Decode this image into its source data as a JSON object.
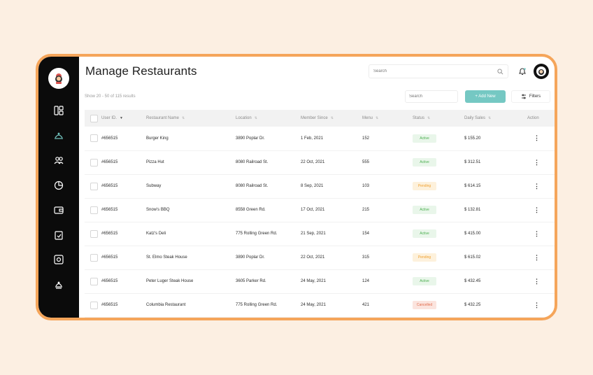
{
  "header": {
    "title": "Manage Restaurants",
    "search_placeholder": "Search"
  },
  "subbar": {
    "results": "Show 20 - 50 of 115 results",
    "search_placeholder": "Search",
    "add_label": "+ Add New",
    "filters_label": "Filters"
  },
  "colors": {
    "accent": "#75c8c3",
    "frame": "#f5a55a",
    "sidebar": "#0b0b0b",
    "active": "#4caf50",
    "pending": "#f0a030",
    "cancelled": "#e06a4a"
  },
  "sidebar": {
    "items": [
      "dashboard-icon",
      "restaurant-icon",
      "users-icon",
      "pie-chart-icon",
      "wallet-icon",
      "clipboard-check-icon",
      "settings-icon",
      "chef-icon"
    ]
  },
  "table": {
    "columns": [
      "User ID.",
      "Restaurant Name",
      "Location",
      "Member Since",
      "Menu",
      "Status",
      "Daily Sales",
      "Action"
    ],
    "rows": [
      {
        "id": "#656515",
        "name": "Burger King",
        "location": "3890 Poplar Dr.",
        "since": "1 Feb, 2021",
        "menu": "152",
        "status": "Active",
        "sales": "$ 155.20"
      },
      {
        "id": "#656515",
        "name": "Pizza Hut",
        "location": "8080 Railroad St.",
        "since": "22 Oct, 2021",
        "menu": "555",
        "status": "Active",
        "sales": "$ 312.51"
      },
      {
        "id": "#656515",
        "name": "Subway",
        "location": "8080 Railroad St.",
        "since": "8 Sep, 2021",
        "menu": "103",
        "status": "Pending",
        "sales": "$ 614.15"
      },
      {
        "id": "#656515",
        "name": "Snow's BBQ",
        "location": "8558 Green Rd.",
        "since": "17 Oct, 2021",
        "menu": "215",
        "status": "Active",
        "sales": "$ 132.81"
      },
      {
        "id": "#656515",
        "name": "Katz's Deli",
        "location": "775 Rolling Green Rd.",
        "since": "21 Sep, 2021",
        "menu": "154",
        "status": "Active",
        "sales": "$ 415.00"
      },
      {
        "id": "#656515",
        "name": "St. Elmo Steak House",
        "location": "3890 Poplar Dr.",
        "since": "22 Oct, 2021",
        "menu": "315",
        "status": "Pending",
        "sales": "$ 615.02"
      },
      {
        "id": "#656515",
        "name": "Peter Luger Steak House",
        "location": "3605 Parker Rd.",
        "since": "24 May, 2021",
        "menu": "124",
        "status": "Active",
        "sales": "$ 432.45"
      },
      {
        "id": "#656515",
        "name": "Columbia Restaurant",
        "location": "775 Rolling Green Rd.",
        "since": "24 May, 2021",
        "menu": "421",
        "status": "Cancelled",
        "sales": "$ 432.25"
      }
    ]
  }
}
